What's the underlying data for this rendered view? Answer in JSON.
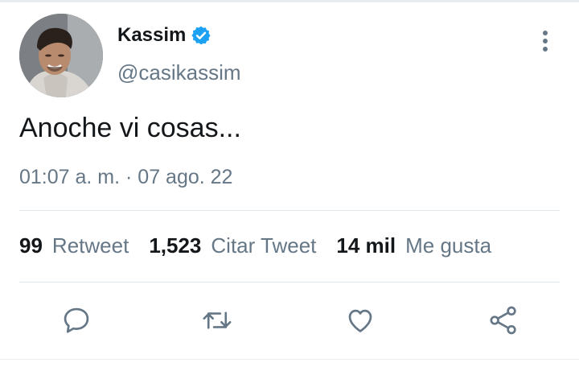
{
  "user": {
    "display_name": "Kassim",
    "handle": "@casikassim",
    "verified": true
  },
  "tweet": {
    "text": "Anoche vi cosas...",
    "timestamp": "01:07 a. m. · 07 ago. 22"
  },
  "stats": [
    {
      "value": "99",
      "label": "Retweet"
    },
    {
      "value": "1,523",
      "label": "Citar Tweet"
    },
    {
      "value": "14 mil",
      "label": "Me gusta"
    }
  ],
  "actions": [
    {
      "icon": "reply-icon"
    },
    {
      "icon": "retweet-icon"
    },
    {
      "icon": "like-icon"
    },
    {
      "icon": "share-icon"
    }
  ],
  "colors": {
    "verified_badge": "#1da1f2",
    "secondary_text": "#657786",
    "primary_text": "#14171a",
    "action_icon": "#657786"
  }
}
